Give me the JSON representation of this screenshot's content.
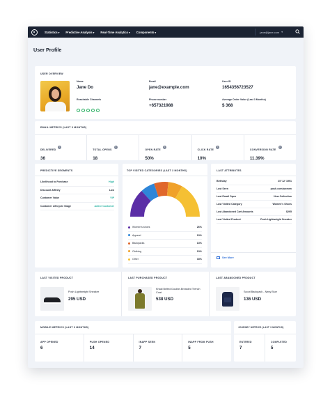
{
  "nav": {
    "items": [
      "Statistics",
      "Predictive Analysis",
      "Real-Time Analytics",
      "Components"
    ],
    "user": "jane@jane.com",
    "colors": {
      "bar": "#1b2333"
    }
  },
  "page_title": "User Profile",
  "overview": {
    "title": "User Overview",
    "name_label": "Name",
    "name": "Jane Do",
    "email_label": "Email",
    "email": "jane@example.com",
    "userid_label": "User ID",
    "userid": "1654356723527",
    "channels_label": "Reachable Channels",
    "phone_label": "Phone number",
    "phone": "+657321988",
    "aov_label": "Average Order Value (Last 3 Months)",
    "aov": "$ 368"
  },
  "email_metrics": {
    "title": "Email Metrics (Last 3 Months)",
    "items": [
      {
        "label": "Delivered",
        "value": "36"
      },
      {
        "label": "Total Opens",
        "value": "18"
      },
      {
        "label": "Open Rate",
        "value": "50%"
      },
      {
        "label": "Click Rate",
        "value": "10%"
      },
      {
        "label": "Conversion Rate",
        "value": "11.39%"
      }
    ]
  },
  "segments": {
    "title": "Predictive Segments",
    "rows": [
      {
        "label": "Likelihood to Purchase",
        "value": "High",
        "color": "#2bb3a3"
      },
      {
        "label": "Discount Affinity",
        "value": "Low",
        "color": "#1c2330"
      },
      {
        "label": "Customer Value",
        "value": "VIP",
        "color": "#2bb3a3"
      },
      {
        "label": "Customer Lifecycle Stage",
        "value": "Active Customer",
        "color": "#2bb3a3"
      }
    ]
  },
  "categories": {
    "title": "Top Visited Categories (Last 3 Months)",
    "items": [
      {
        "label": "Women's shoes",
        "value": "26%",
        "pct": 26,
        "color": "#5b2ea6"
      },
      {
        "label": "Apparel",
        "value": "13%",
        "pct": 13,
        "color": "#2f86d8"
      },
      {
        "label": "Backpacks",
        "value": "13%",
        "pct": 13,
        "color": "#e0672b"
      },
      {
        "label": "Clothing",
        "value": "13%",
        "pct": 13,
        "color": "#f0a12a"
      },
      {
        "label": "Other",
        "value": "33%",
        "pct": 33,
        "color": "#f5c033"
      }
    ]
  },
  "attributes": {
    "title": "Last Attributes",
    "rows": [
      {
        "label": "Birthday",
        "value": "25 '12 '1991"
      },
      {
        "label": "Last Seen",
        "value": "posh.com/women"
      },
      {
        "label": "Last Email Open",
        "value": "New Collection"
      },
      {
        "label": "Last Visited Category",
        "value": "Women's Shoes"
      },
      {
        "label": "Last Abandoned Cart Amounts",
        "value": "$295"
      },
      {
        "label": "Last Visited Product",
        "value": "Posh Lightweight Sneaker"
      }
    ],
    "see_more": "See More"
  },
  "products": [
    {
      "title": "Last Visited Product",
      "name": "Posh Lightweight Sneaker",
      "price": "295 USD"
    },
    {
      "title": "Last Purchased Product",
      "name": "Khaki Belted Double-Breasted Trench Coat",
      "price": "538 USD"
    },
    {
      "title": "Last Abandoned Product",
      "name": "Scout Backpack - Navy Blue",
      "price": "136 USD"
    }
  ],
  "mobile": {
    "title": "Mobile Metrics (Last 3 Months)",
    "items": [
      {
        "label": "App Opened",
        "value": "6"
      },
      {
        "label": "Push Opened",
        "value": "14"
      },
      {
        "label": "Inapp Seen",
        "value": "7"
      },
      {
        "label": "Inapp From Push",
        "value": "5"
      }
    ]
  },
  "journey": {
    "title": "Journey Metrics (Last 3 Months)",
    "items": [
      {
        "label": "Entered",
        "value": "7"
      },
      {
        "label": "Completed",
        "value": "5"
      }
    ]
  }
}
